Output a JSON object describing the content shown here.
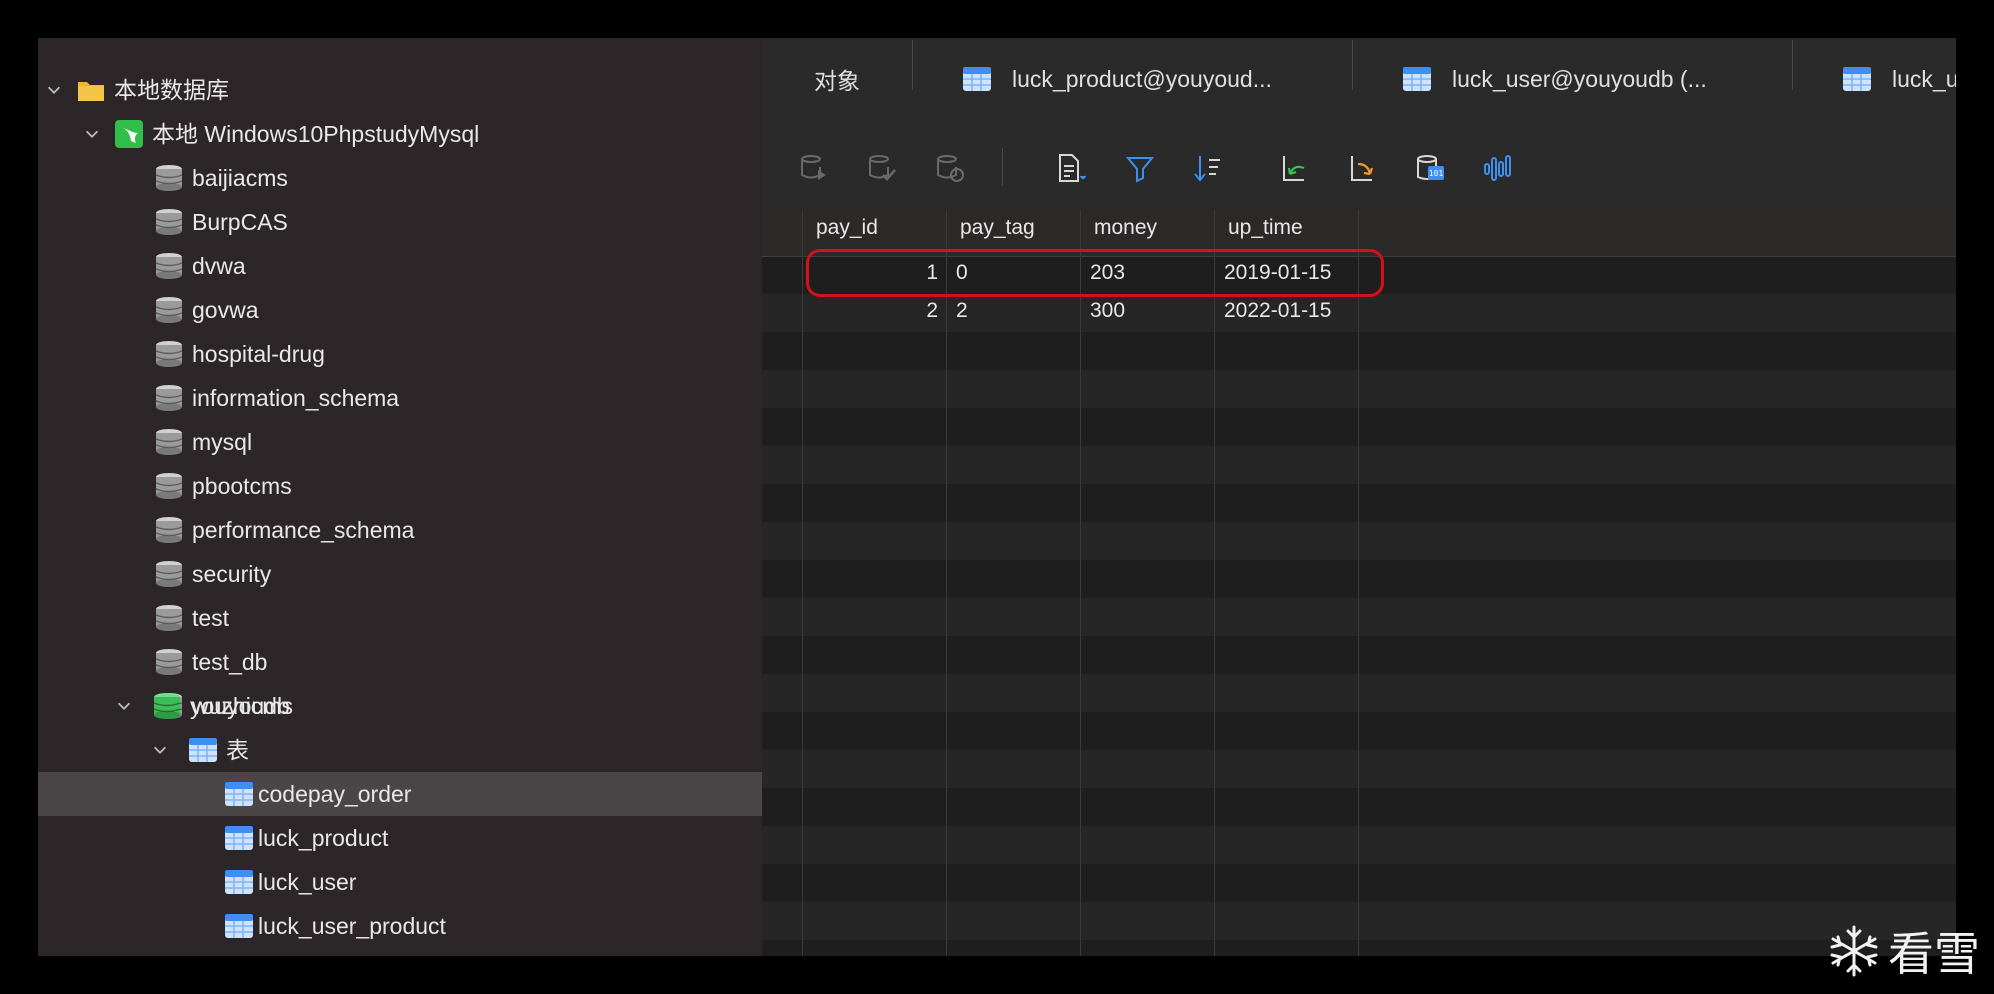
{
  "sidebar": {
    "root_label": "本地数据库",
    "connection_label": "本地 Windows10PhpstudyMysql",
    "databases": [
      "baijiacms",
      "BurpCAS",
      "dvwa",
      "govwa",
      "hospital-drug",
      "information_schema",
      "mysql",
      "pbootcms",
      "performance_schema",
      "security",
      "test",
      "test_db",
      "wuzhicms"
    ],
    "open_database": "youyoudb",
    "tables_group_label": "表",
    "tables": [
      "codepay_order",
      "luck_product",
      "luck_user",
      "luck_user_product"
    ],
    "selected_table": "codepay_order"
  },
  "tabs": [
    {
      "label": "对象"
    },
    {
      "label": "luck_product@youyoud..."
    },
    {
      "label": "luck_user@youyoudb (..."
    },
    {
      "label": "luck_u"
    }
  ],
  "toolbar": {
    "icons": [
      "db-run-icon",
      "db-check-icon",
      "db-refresh-icon",
      "document-menu-icon",
      "filter-icon",
      "sort-icon",
      "import-icon",
      "export-icon",
      "binary-data-icon",
      "chart-icon"
    ]
  },
  "grid": {
    "columns": [
      "pay_id",
      "pay_tag",
      "money",
      "up_time"
    ],
    "rows": [
      {
        "pay_id": "1",
        "pay_tag": "0",
        "money": "203",
        "up_time": "2019-01-15"
      },
      {
        "pay_id": "2",
        "pay_tag": "2",
        "money": "300",
        "up_time": "2022-01-15"
      }
    ]
  },
  "colors": {
    "sidebar_bg": "#2d2628",
    "selected_row": "#4a4648",
    "highlight_border": "#d51018",
    "table_icon": "#3d8ff0",
    "folder_icon": "#f4b330",
    "open_db_icon": "#3cbd56"
  },
  "watermark": {
    "text": "看雪"
  }
}
